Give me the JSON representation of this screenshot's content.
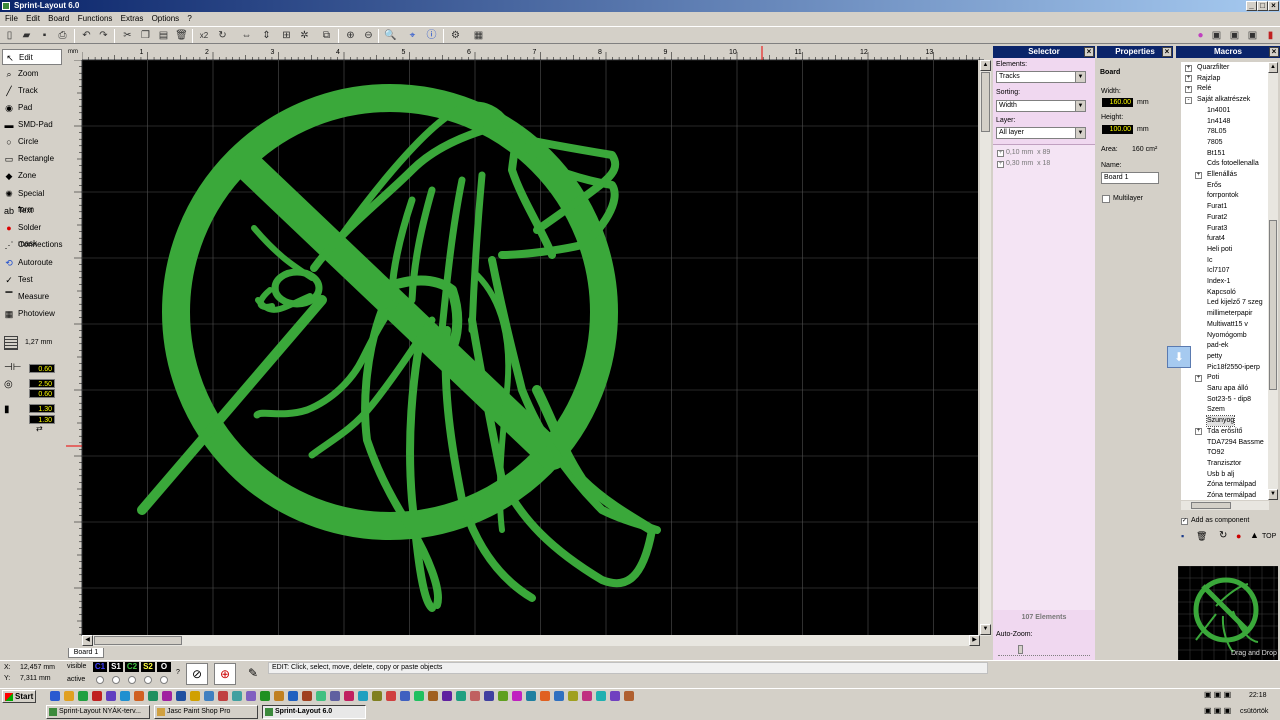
{
  "window": {
    "title": "Sprint-Layout 6.0"
  },
  "menu": [
    "File",
    "Edit",
    "Board",
    "Functions",
    "Extras",
    "Options",
    "?"
  ],
  "toolbar": {
    "zoom_label": "x2"
  },
  "tools": [
    {
      "label": "Edit",
      "icon": "arrow-icon"
    },
    {
      "label": "Zoom",
      "icon": "magnifier-icon"
    },
    {
      "label": "Track",
      "icon": "track-icon"
    },
    {
      "label": "Pad",
      "icon": "pad-icon"
    },
    {
      "label": "SMD-Pad",
      "icon": "smd-pad-icon"
    },
    {
      "label": "Circle",
      "icon": "circle-icon"
    },
    {
      "label": "Rectangle",
      "icon": "rectangle-icon"
    },
    {
      "label": "Zone",
      "icon": "zone-icon"
    },
    {
      "label": "Special form",
      "icon": "special-form-icon"
    },
    {
      "label": "Text",
      "icon": "text-icon"
    },
    {
      "label": "Solder mask",
      "icon": "solder-mask-icon"
    },
    {
      "label": "Connections",
      "icon": "connections-icon"
    },
    {
      "label": "Autoroute",
      "icon": "autoroute-icon"
    },
    {
      "label": "Test",
      "icon": "test-icon"
    },
    {
      "label": "Measure",
      "icon": "measure-icon"
    },
    {
      "label": "Photoview",
      "icon": "photoview-icon"
    }
  ],
  "grid": {
    "value": "1,27 mm"
  },
  "params": [
    "0.60",
    "2.50",
    "0.60",
    "1.30",
    "1.30"
  ],
  "ruler": {
    "unit": "mm",
    "ticks": [
      "1",
      "2",
      "3",
      "4",
      "5",
      "6",
      "7",
      "8",
      "9",
      "10",
      "11",
      "12",
      "13",
      "14",
      "15",
      "16",
      "17"
    ]
  },
  "board_tab": "Board 1",
  "selector": {
    "title": "Selector",
    "elements_label": "Elements:",
    "elements_value": "Tracks",
    "sorting_label": "Sorting:",
    "sorting_value": "Width",
    "layer_label": "Layer:",
    "layer_value": "All layer",
    "items": [
      {
        "size": "0,10 mm",
        "count": "x 89"
      },
      {
        "size": "0,30 mm",
        "count": "x 18"
      }
    ],
    "footer": "107 Elements",
    "autozoom_label": "Auto-Zoom:"
  },
  "properties": {
    "title": "Properties",
    "section": "Board",
    "width_label": "Width:",
    "width_value": "160.00",
    "height_label": "Height:",
    "height_value": "100.00",
    "unit": "mm",
    "area_label": "Area:",
    "area_value": "160 cm²",
    "name_label": "Name:",
    "name_value": "Board 1",
    "multilayer_label": "Multilayer"
  },
  "macros": {
    "title": "Macros",
    "tree": [
      {
        "label": "Quarzfilter",
        "level": 1,
        "expander": "+"
      },
      {
        "label": "Rajzlap",
        "level": 1,
        "expander": "+"
      },
      {
        "label": "Relé",
        "level": 1,
        "expander": "+"
      },
      {
        "label": "Saját alkatrészek",
        "level": 1,
        "expander": "-"
      },
      {
        "label": "1n4001",
        "level": 2
      },
      {
        "label": "1n4148",
        "level": 2
      },
      {
        "label": "78L05",
        "level": 2
      },
      {
        "label": "7805",
        "level": 2
      },
      {
        "label": "Bt151",
        "level": 2
      },
      {
        "label": "Cds fotoellenalla",
        "level": 2
      },
      {
        "label": "Ellenállás",
        "level": 2,
        "expander": "+"
      },
      {
        "label": "Erős",
        "level": 2
      },
      {
        "label": "forrpontok",
        "level": 2
      },
      {
        "label": "Furat1",
        "level": 2
      },
      {
        "label": "Furat2",
        "level": 2
      },
      {
        "label": "Furat3",
        "level": 2
      },
      {
        "label": "furat4",
        "level": 2
      },
      {
        "label": "Heli poti",
        "level": 2
      },
      {
        "label": "Ic",
        "level": 2
      },
      {
        "label": "Icl7107",
        "level": 2
      },
      {
        "label": "Index-1",
        "level": 2
      },
      {
        "label": "Kapcsoló",
        "level": 2
      },
      {
        "label": "Led kijelző 7 szeg",
        "level": 2
      },
      {
        "label": "millimeterpapir",
        "level": 2
      },
      {
        "label": "Multiwatt15  v",
        "level": 2
      },
      {
        "label": "Nyomógomb",
        "level": 2
      },
      {
        "label": "pad-ek",
        "level": 2
      },
      {
        "label": "petty",
        "level": 2
      },
      {
        "label": "Pic18f2550-iperp",
        "level": 2
      },
      {
        "label": "Poti",
        "level": 2,
        "expander": "+"
      },
      {
        "label": "Saru apa álló",
        "level": 2
      },
      {
        "label": "Sot23-5 - dip8",
        "level": 2
      },
      {
        "label": "Szem",
        "level": 2
      },
      {
        "label": "Szunyog",
        "level": 2,
        "selected": true
      },
      {
        "label": "Tda erősítő",
        "level": 2,
        "expander": "+"
      },
      {
        "label": "TDA7294 Bassme",
        "level": 2
      },
      {
        "label": "TO92",
        "level": 2
      },
      {
        "label": "Tranzisztor",
        "level": 2
      },
      {
        "label": "Usb b alj",
        "level": 2
      },
      {
        "label": "Zóna termálpad",
        "level": 2
      },
      {
        "label": "Zóna termálpad",
        "level": 2
      }
    ],
    "add_component_label": "Add as component",
    "top_label": "TOP",
    "preview_caption": "Drag and Drop"
  },
  "status": {
    "x_label": "X:",
    "x_value": "12,457 mm",
    "y_label": "Y:",
    "y_value": "7,311 mm",
    "visible_label": "visible",
    "active_label": "active",
    "layers": [
      "C1",
      "S1",
      "C2",
      "S2",
      "O"
    ],
    "layer_colors": [
      "#4040ff",
      "#ffffff",
      "#40c040",
      "#ffff40",
      "#ffffff"
    ],
    "question": "?",
    "message": "EDIT: Click, select, move, delete, copy or paste objects"
  },
  "taskbar": {
    "start": "Start",
    "tasks": [
      {
        "label": "Sprint-Layout NYÁK-terv...",
        "active": false
      },
      {
        "label": "Jasc Paint Shop Pro",
        "active": false
      },
      {
        "label": "Sprint-Layout 6.0",
        "active": true
      }
    ],
    "clock_time": "22:18",
    "clock_day": "csütörtök"
  },
  "colors": {
    "trace": "#3aa83a",
    "canvas": "#000000",
    "title": "#0a246a",
    "value_bg": "#000000",
    "value_fg": "#ffff00"
  }
}
